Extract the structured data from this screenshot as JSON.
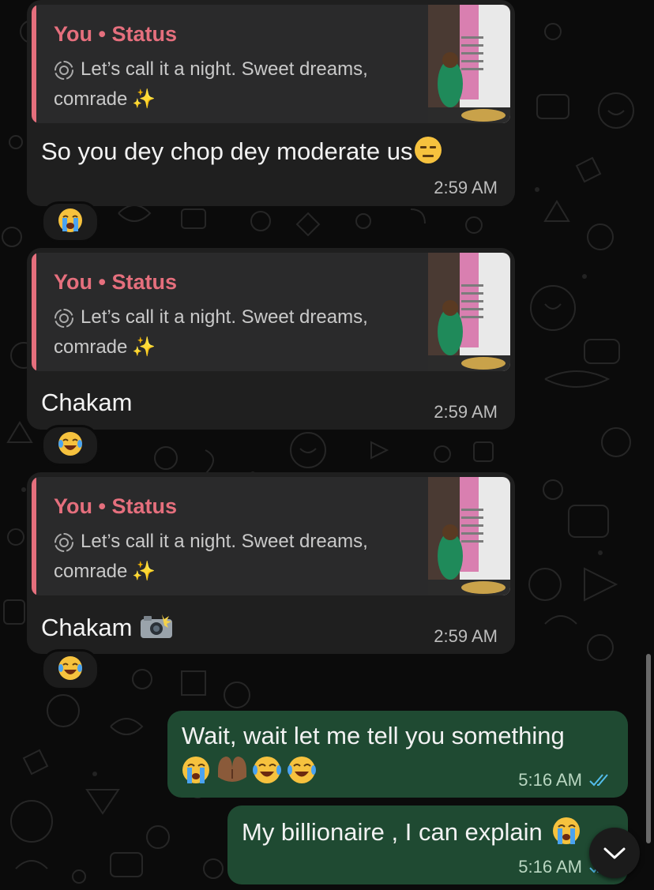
{
  "messages": [
    {
      "direction": "incoming",
      "reply": {
        "title": "You • Status",
        "line1": "Let’s call it a night. Sweet dreams,",
        "line2": "comrade",
        "sparkle": "✨"
      },
      "text": "So you dey chop dey moderate us",
      "text_emoji": "😑",
      "time": "2:59 AM",
      "reaction": "😭"
    },
    {
      "direction": "incoming",
      "reply": {
        "title": "You • Status",
        "line1": "Let’s call it a night. Sweet dreams,",
        "line2": "comrade",
        "sparkle": "✨"
      },
      "text": "Chakam",
      "time": "2:59 AM",
      "reaction": "😂"
    },
    {
      "direction": "incoming",
      "reply": {
        "title": "You • Status",
        "line1": "Let’s call it a night. Sweet dreams,",
        "line2": "comrade",
        "sparkle": "✨"
      },
      "text": "Chakam",
      "text_emoji": "📸",
      "time": "2:59 AM",
      "reaction": "😂"
    },
    {
      "direction": "outgoing",
      "text": "Wait, wait let me tell you something",
      "emoji_line": "😭🤲🏾😂😂",
      "time": "5:16 AM",
      "status": "read",
      "status_icon": "double-check-icon"
    },
    {
      "direction": "outgoing",
      "text": "My billionaire , I can explain",
      "text_emoji": "😭",
      "time": "5:16 AM",
      "status": "read",
      "status_icon": "double-check-icon"
    }
  ],
  "icons": {
    "status_ring": "status-ring-icon",
    "scroll_down": "chevron-down-icon"
  },
  "colors": {
    "background": "#0b0b0b",
    "incoming_bubble": "#1f1f1f",
    "outgoing_bubble": "#1f4a32",
    "reply_accent": "#e56f7d",
    "read_ticks": "#53bdeb"
  }
}
